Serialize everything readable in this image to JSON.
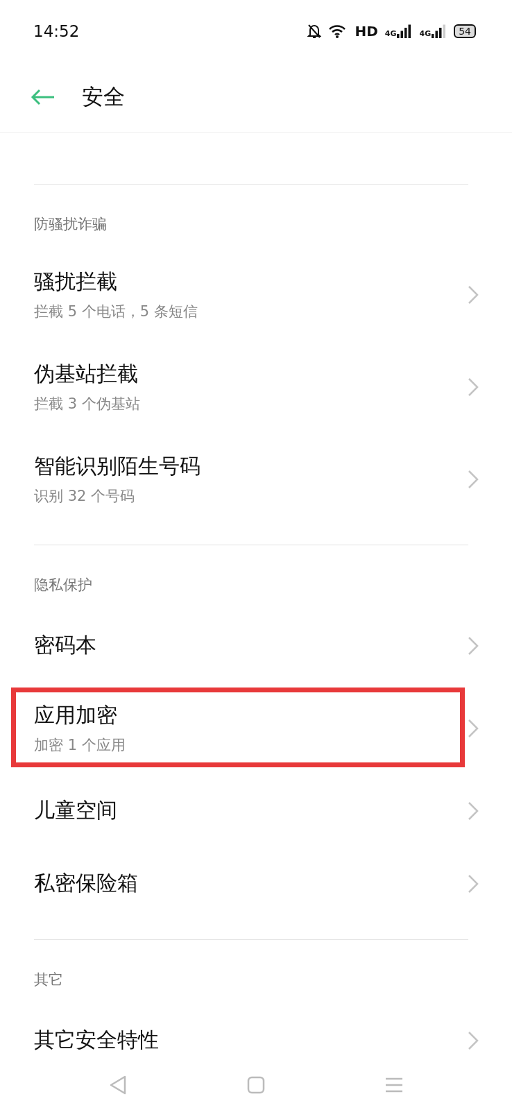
{
  "status_bar": {
    "time": "14:52",
    "network": "HD",
    "sim_1": "4G",
    "sim_2": "4G",
    "battery": "54"
  },
  "header": {
    "title": "安全"
  },
  "sections": [
    {
      "label": "防骚扰诈骗",
      "items": [
        {
          "title": "骚扰拦截",
          "subtitle": "拦截 5 个电话，5 条短信",
          "highlighted": false
        },
        {
          "title": "伪基站拦截",
          "subtitle": "拦截 3 个伪基站",
          "highlighted": false
        },
        {
          "title": "智能识别陌生号码",
          "subtitle": "识别 32 个号码",
          "highlighted": false
        }
      ]
    },
    {
      "label": "隐私保护",
      "items": [
        {
          "title": "密码本",
          "highlighted": false
        },
        {
          "title": "应用加密",
          "subtitle": "加密 1 个应用",
          "highlighted": true
        },
        {
          "title": "儿童空间",
          "highlighted": false
        },
        {
          "title": "私密保险箱",
          "highlighted": false
        }
      ]
    },
    {
      "label": "其它",
      "items": [
        {
          "title": "其它安全特性",
          "highlighted": false
        }
      ]
    }
  ]
}
